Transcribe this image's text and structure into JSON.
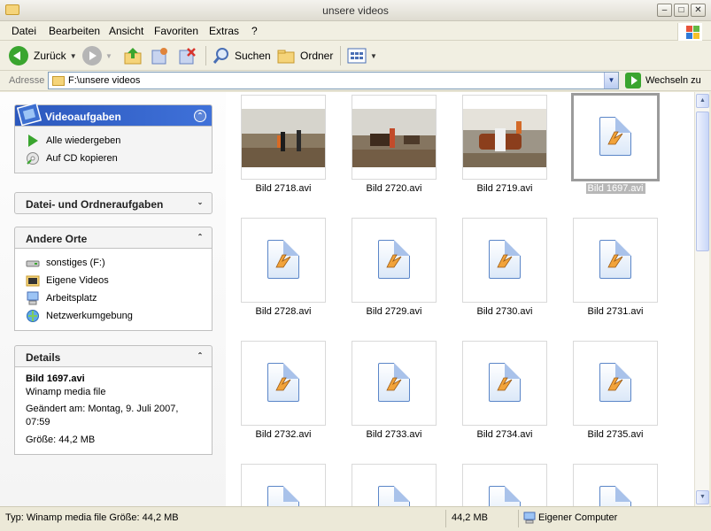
{
  "window": {
    "title": "unsere videos"
  },
  "menu": [
    "Datei",
    "Bearbeiten",
    "Ansicht",
    "Favoriten",
    "Extras",
    "?"
  ],
  "toolbar": {
    "back_label": "Zurück",
    "search_label": "Suchen",
    "folders_label": "Ordner"
  },
  "address": {
    "label": "Adresse",
    "value": "F:\\unsere videos",
    "go_label": "Wechseln zu"
  },
  "taskpane": {
    "video_tasks": {
      "title": "Videoaufgaben",
      "items": [
        "Alle wiedergeben",
        "Auf CD kopieren"
      ]
    },
    "file_tasks": {
      "title": "Datei- und Ordneraufgaben"
    },
    "other_places": {
      "title": "Andere Orte",
      "items": [
        "sonstiges (F:)",
        "Eigene Videos",
        "Arbeitsplatz",
        "Netzwerkumgebung"
      ]
    },
    "details": {
      "title": "Details",
      "name": "Bild 1697.avi",
      "type": "Winamp media file",
      "modified": "Geändert am: Montag, 9. Juli 2007, 07:59",
      "modified_line1": "Geändert am: Montag, 9. Juli 2007,",
      "modified_line2": "07:59",
      "size": "Größe: 44,2 MB"
    }
  },
  "files": [
    "Bild 2718.avi",
    "Bild 2720.avi",
    "Bild 2719.avi",
    "Bild 1697.avi",
    "Bild 2728.avi",
    "Bild 2729.avi",
    "Bild 2730.avi",
    "Bild 2731.avi",
    "Bild 2732.avi",
    "Bild 2733.avi",
    "Bild 2734.avi",
    "Bild 2735.avi"
  ],
  "selected_file": "Bild 1697.avi",
  "statusbar": {
    "type_info": "Typ: Winamp media file Größe: 44,2 MB",
    "size": "44,2 MB",
    "location": "Eigener Computer"
  },
  "colors": {
    "xp_blue": "#215dc6",
    "selection_gray": "#b7b7b7",
    "go_green": "#3aa52f"
  }
}
